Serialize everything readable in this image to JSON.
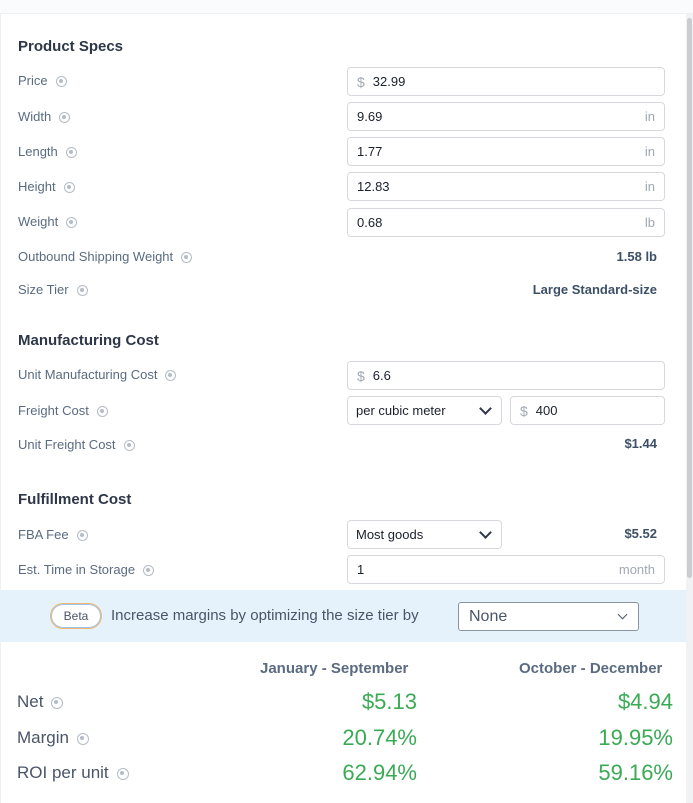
{
  "product_specs": {
    "title": "Product Specs",
    "price": {
      "label": "Price",
      "currency": "$",
      "value": "32.99"
    },
    "width": {
      "label": "Width",
      "value": "9.69",
      "unit": "in"
    },
    "length": {
      "label": "Length",
      "value": "1.77",
      "unit": "in"
    },
    "height": {
      "label": "Height",
      "value": "12.83",
      "unit": "in"
    },
    "weight": {
      "label": "Weight",
      "value": "0.68",
      "unit": "lb"
    },
    "outbound_shipping_weight": {
      "label": "Outbound Shipping Weight",
      "value": "1.58 lb"
    },
    "size_tier": {
      "label": "Size Tier",
      "value": "Large Standard-size"
    }
  },
  "manufacturing_cost": {
    "title": "Manufacturing Cost",
    "unit_manufacturing_cost": {
      "label": "Unit Manufacturing Cost",
      "currency": "$",
      "value": "6.6"
    },
    "freight_cost": {
      "label": "Freight Cost",
      "basis": "per cubic meter",
      "currency": "$",
      "value": "400"
    },
    "unit_freight_cost": {
      "label": "Unit Freight Cost",
      "value": "$1.44"
    }
  },
  "fulfillment_cost": {
    "title": "Fulfillment Cost",
    "fba_fee": {
      "label": "FBA Fee",
      "category": "Most goods",
      "value": "$5.52"
    },
    "storage_time": {
      "label": "Est. Time in Storage",
      "value": "1",
      "unit": "month"
    }
  },
  "beta": {
    "badge": "Beta",
    "text": "Increase margins by optimizing the size tier by",
    "selected": "None"
  },
  "results": {
    "columns": [
      "January - September",
      "October - December"
    ],
    "net": {
      "label": "Net",
      "values": [
        "$5.13",
        "$4.94"
      ]
    },
    "margin": {
      "label": "Margin",
      "values": [
        "20.74%",
        "19.95%"
      ]
    },
    "roi": {
      "label": "ROI per unit",
      "values": [
        "62.94%",
        "59.16%"
      ]
    }
  },
  "colors": {
    "positive": "#3aaa55",
    "beta_bar": "#e6f2fb",
    "heading": "#2d3748"
  }
}
